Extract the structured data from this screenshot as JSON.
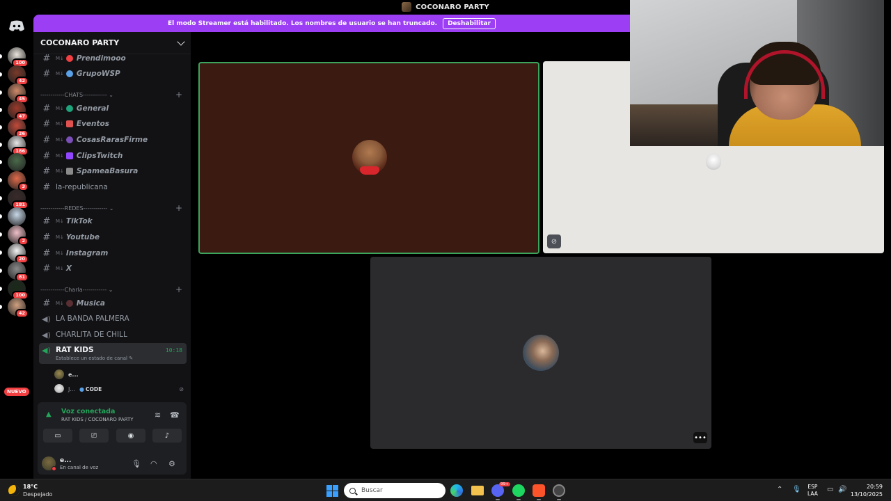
{
  "window": {
    "title": "COCONARO PARTY"
  },
  "banner": {
    "message": "El modo Streamer está habilitado. Los nombres de usuario se han truncado.",
    "button": "Deshabilitar"
  },
  "rail": {
    "badges": [
      "100",
      "42",
      "45",
      "47",
      "26",
      "186",
      "",
      "3",
      "181",
      "",
      "2",
      "20",
      "81",
      "100",
      "42"
    ],
    "new_label": "NUEVO"
  },
  "server": {
    "name": "COCONARO PARTY"
  },
  "channels_top": [
    {
      "label": "Prendimooo",
      "color": "#f23f42"
    },
    {
      "label": "GrupoWSP",
      "color": "#5aa0e6"
    }
  ],
  "categories": {
    "chats": "------------CHATS------------ ⌄",
    "redes": "------------REDES------------ ⌄",
    "charla": "------------Charla------------ ⌄"
  },
  "chats": [
    {
      "label": "General",
      "color": "#1ea37a"
    },
    {
      "label": "Eventos",
      "color": "#e0524f"
    },
    {
      "label": "CosasRarasFirme",
      "color": "#7a4fb8"
    },
    {
      "label": "ClipsTwitch",
      "color": "#9146ff"
    },
    {
      "label": "SpameaBasura",
      "color": "#8a8a8a"
    }
  ],
  "plain_channel": "la-republicana",
  "redes": [
    "TikTok",
    "Youtube",
    "Instagram",
    "X"
  ],
  "charla": {
    "text_channel": "Musica",
    "voice_channels": [
      "LA BANDA PALMERA",
      "CHARLITA DE CHILL"
    ],
    "active_voice": {
      "name": "RAT KIDS",
      "time": "10:18",
      "status_prompt": "Establece un estado de canal"
    },
    "members": [
      {
        "name": "e..."
      },
      {
        "name": "J...",
        "tag": "CODE"
      }
    ]
  },
  "voice_panel": {
    "status": "Voz conectada",
    "location": "RAT KIDS / COCONARO PARTY",
    "user_name": "e...",
    "user_status": "En canal de voz"
  },
  "taskbar": {
    "temperature": "18°C",
    "condition": "Despejado",
    "search_placeholder": "Buscar",
    "lang_top": "ESP",
    "lang_bottom": "LAA",
    "time": "20:59",
    "date": "13/10/2025",
    "discord_badge": "99+"
  },
  "colors": {
    "accent_streamer": "#9b3ef4",
    "voice_green": "#23a55a",
    "sidebar_bg": "#121214"
  }
}
